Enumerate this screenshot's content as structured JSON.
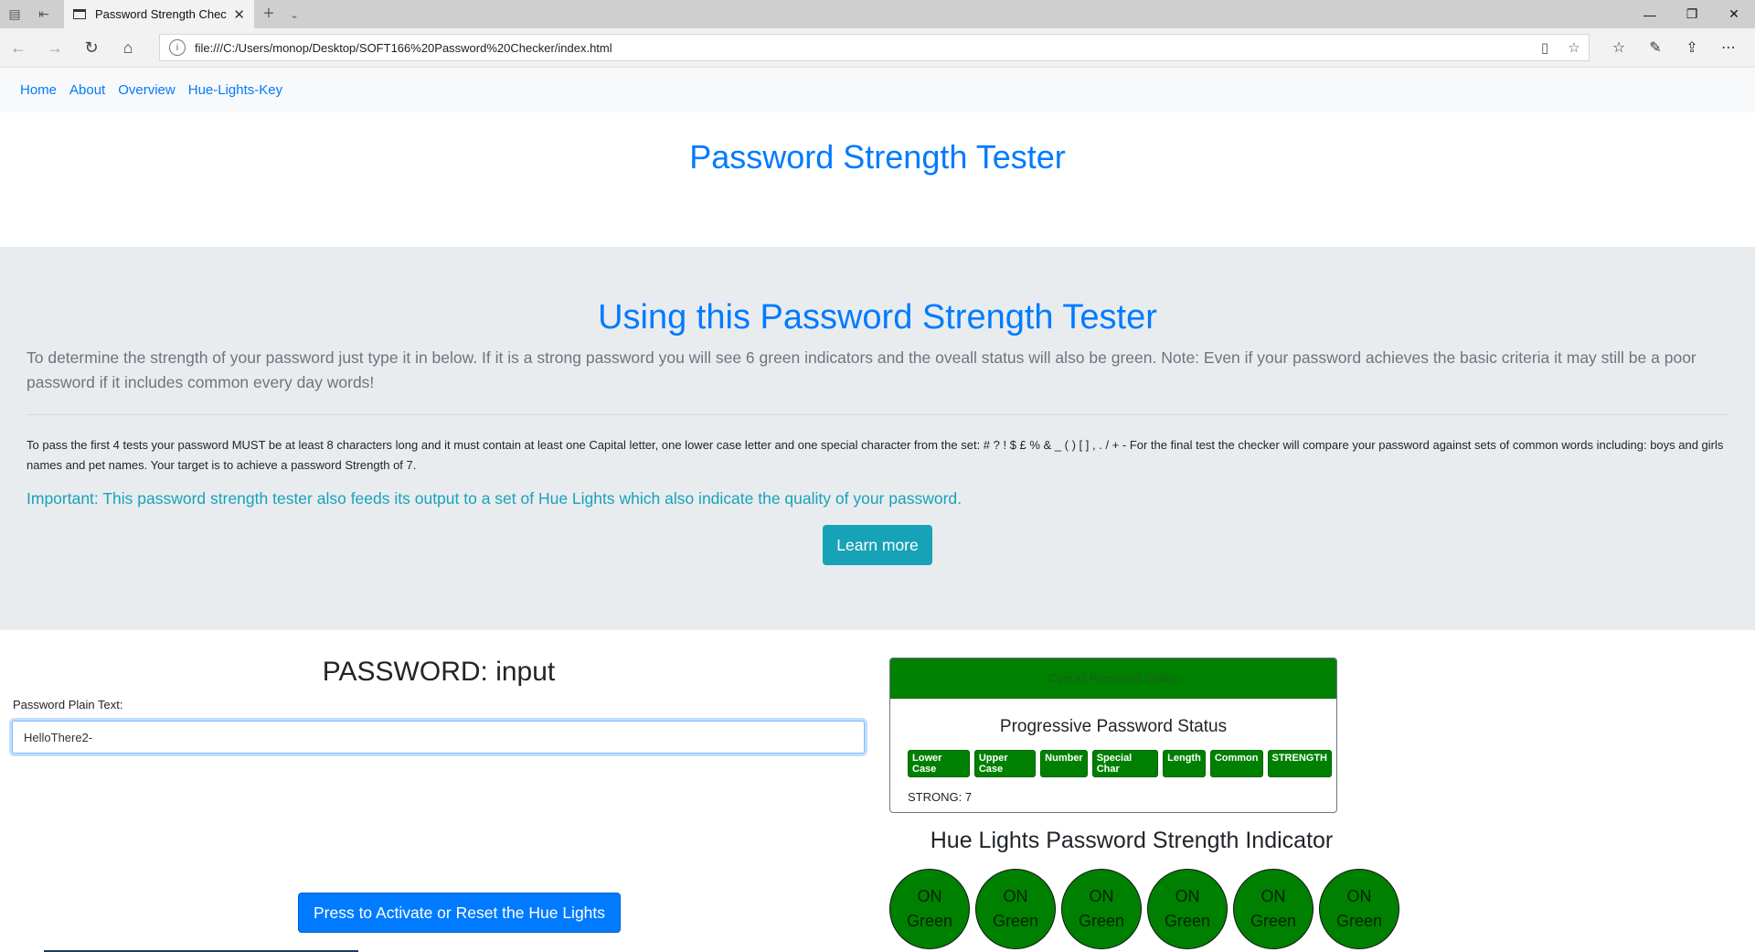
{
  "browser": {
    "tab_title": "Password Strength Chec",
    "url": "file:///C:/Users/monop/Desktop/SOFT166%20Password%20Checker/index.html"
  },
  "nav": {
    "items": [
      "Home",
      "About",
      "Overview",
      "Hue-Lights-Key"
    ]
  },
  "site_title": "Password Strength Tester",
  "jumbotron": {
    "heading": "Using this Password Strength Tester",
    "lead": "To determine the strength of your password just type it in below. If it is a strong password you will see 6 green indicators and the oveall status will also be green. Note: Even if your password achieves the basic criteria it may still be a poor password if it includes common every day words!",
    "rules": "To pass the first 4 tests your password MUST be at least 8 characters long and it must contain at least one Capital letter, one lower case letter and one special character from the set: # ? ! $ £ % & _ ( ) [ ] , . / + - For the final test the checker will compare your password against sets of common words including: boys and girls names and pet names. Your target is to achieve a password Strength of 7.",
    "important": "Important: This password strength tester also feeds its output to a set of Hue Lights which also indicate the quality of your password.",
    "learn_more": "Learn more"
  },
  "password": {
    "title": "PASSWORD: input",
    "label": "Password Plain Text:",
    "value": "HelloThere2-"
  },
  "hue_button": "Press to Activate or Reset the Hue Lights",
  "status_card": {
    "header": "Overall Password Status",
    "title": "Progressive Password Status",
    "badges": [
      "Lower Case",
      "Upper Case",
      "Number",
      "Special Char",
      "Length",
      "Common",
      "STRENGTH"
    ],
    "badge_color": "#008000",
    "strength_text": "STRONG: 7"
  },
  "hue_lights": {
    "title": "Hue Lights Password Strength Indicator",
    "state": "ON",
    "color_name": "Green",
    "color": "#008000",
    "count": 6
  }
}
